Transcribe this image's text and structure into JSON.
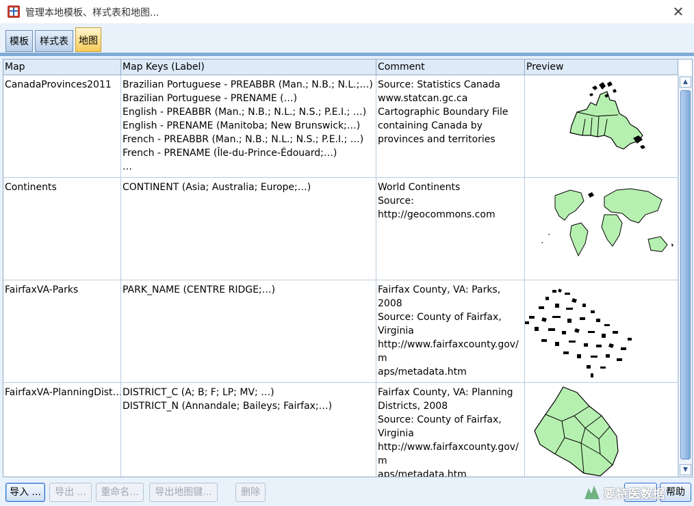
{
  "window": {
    "title": "管理本地模板、样式表和地图...",
    "close_glyph": "✕"
  },
  "tabs": [
    {
      "label": "模板",
      "active": false
    },
    {
      "label": "样式表",
      "active": false
    },
    {
      "label": "地图",
      "active": true
    }
  ],
  "table": {
    "columns": [
      "Map",
      "Map Keys (Label)",
      "Comment",
      "Preview"
    ],
    "rows": [
      {
        "map": "CanadaProvinces2011",
        "keys": [
          "Brazilian Portuguese - PREABBR (Man.; N.B.; N.L.;…)",
          "Brazilian Portuguese - PRENAME (…)",
          "English - PREABBR (Man.; N.B.; N.L.; N.S.; P.E.I.; …)",
          "English - PRENAME (Manitoba; New Brunswick;…)",
          "French - PREABBR (Man.; N.B.; N.L.; N.S.; P.E.I.; …)",
          "French - PRENAME (Île-du-Prince-Édouard;…)",
          "…"
        ],
        "comment": [
          "Source:  Statistics Canada",
          "www.statcan.gc.ca",
          "Cartographic Boundary File",
          "containing Canada by",
          "provinces and territories"
        ],
        "preview_icon": "canada-map-thumbnail"
      },
      {
        "map": "Continents",
        "keys": [
          "CONTINENT (Asia; Australia; Europe;…)"
        ],
        "comment": [
          "World Continents",
          "Source:",
          "http://geocommons.com"
        ],
        "preview_icon": "world-map-thumbnail"
      },
      {
        "map": "FairfaxVA-Parks",
        "keys": [
          "PARK_NAME (CENTRE RIDGE;…)"
        ],
        "comment": [
          "Fairfax County, VA: Parks,",
          "2008",
          "Source: County of Fairfax,",
          "Virginia",
          "http://www.fairfaxcounty.gov/m",
          "aps/metadata.htm"
        ],
        "preview_icon": "parks-map-thumbnail"
      },
      {
        "map": "FairfaxVA-PlanningDist…",
        "keys": [
          "DISTRICT_C (A; B; F; LP; MV; …)",
          "DISTRICT_N (Annandale; Baileys; Fairfax;…)"
        ],
        "comment": [
          "Fairfax County, VA: Planning",
          "Districts, 2008",
          "Source: County of Fairfax,",
          "Virginia",
          "http://www.fairfaxcounty.gov/m",
          "aps/metadata.htm"
        ],
        "preview_icon": "districts-map-thumbnail"
      }
    ]
  },
  "buttons": {
    "import": "导入 ...",
    "export": "导出 ...",
    "rename": "重命名...",
    "export_keys": "导出地图键...",
    "delete": "删除",
    "help": "帮助"
  },
  "watermark": "要特医数据",
  "colors": {
    "map_fill": "#b6f0b0",
    "active_tab": "#f8cb58",
    "accent": "#2e6fd1"
  }
}
